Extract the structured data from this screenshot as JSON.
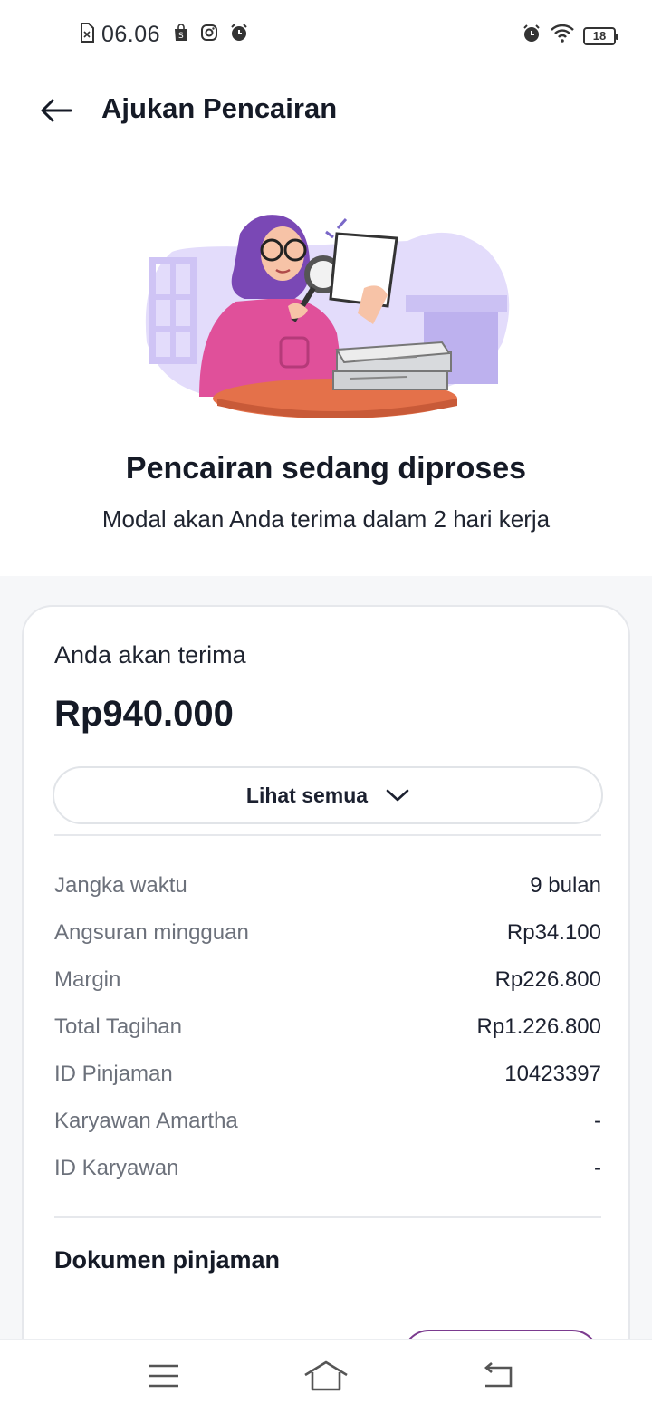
{
  "status_bar": {
    "time": "06.06",
    "battery": "18"
  },
  "header": {
    "title": "Ajukan Pencairan"
  },
  "hero": {
    "title": "Pencairan sedang diproses",
    "subtitle": "Modal akan Anda terima dalam 2 hari kerja"
  },
  "card": {
    "receive_label": "Anda akan terima",
    "receive_amount": "Rp940.000",
    "see_all_label": "Lihat semua",
    "rows": [
      {
        "label": "Jangka waktu",
        "value": "9 bulan"
      },
      {
        "label": "Angsuran mingguan",
        "value": "Rp34.100"
      },
      {
        "label": "Margin",
        "value": "Rp226.800"
      },
      {
        "label": "Total Tagihan",
        "value": "Rp1.226.800"
      },
      {
        "label": "ID Pinjaman",
        "value": "10423397"
      },
      {
        "label": "Karyawan Amartha",
        "value": "-"
      },
      {
        "label": "ID Karyawan",
        "value": "-"
      }
    ],
    "documents_title": "Dokumen pinjaman"
  },
  "colors": {
    "accent_purple": "#7b3b8f",
    "illustration_bg": "#e3dcfb"
  },
  "icons": [
    "back-arrow-icon",
    "chevron-down-icon",
    "menu-icon",
    "home-icon",
    "return-icon"
  ]
}
